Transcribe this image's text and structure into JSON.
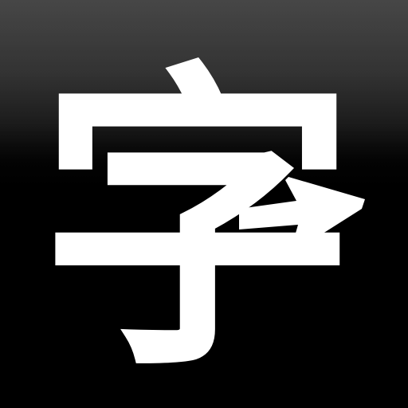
{
  "app_icon": {
    "glyph": "字",
    "glyph_color": "#ffffff",
    "background_top_color": "#3b3b3b",
    "background_bottom_color": "#000000",
    "arrow_icon": "right-arrow-icon"
  }
}
